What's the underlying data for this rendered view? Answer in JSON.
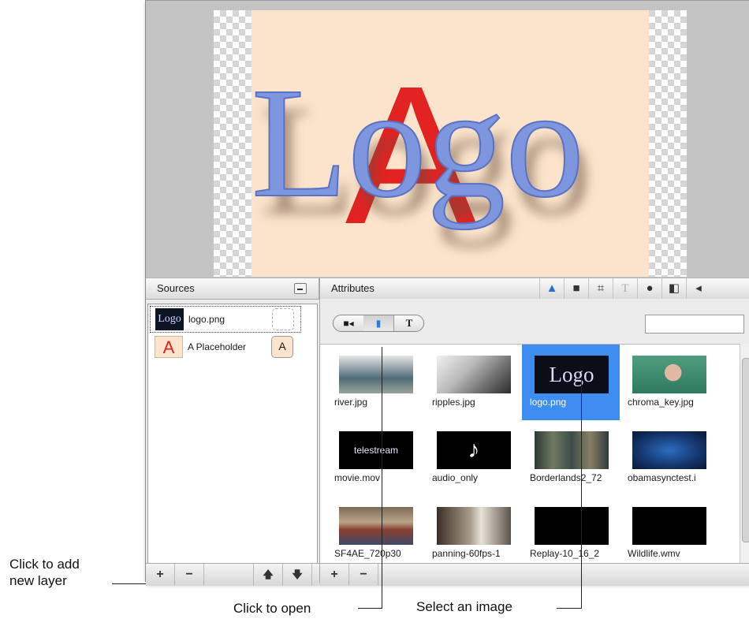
{
  "annotations": {
    "add_layer": "Click to add\nnew layer",
    "open": "Click to open",
    "select_image": "Select an image"
  },
  "preview": {
    "logo_text": "Logo",
    "placeholder_letter": "A"
  },
  "sources": {
    "title": "Sources",
    "items": [
      {
        "label": "logo.png",
        "thumb_text": "Logo"
      },
      {
        "label": "A Placeholder",
        "thumb_text": "A",
        "button_text": "A"
      }
    ],
    "toolbar": {
      "add": "+",
      "remove": "−",
      "up": "🡅",
      "down": "🡇"
    }
  },
  "attributes": {
    "title": "Attributes",
    "tabs": [
      "shapes-icon",
      "folder-icon",
      "crop-icon",
      "text-icon",
      "person-icon",
      "split-icon",
      "speaker-icon"
    ],
    "segment": {
      "video": "■◂",
      "image": "▮",
      "text": "T"
    },
    "search": {
      "value": "",
      "placeholder": ""
    },
    "media": [
      {
        "name": "river.jpg",
        "selected": false
      },
      {
        "name": "ripples.jpg",
        "selected": false
      },
      {
        "name": "logo.png",
        "selected": true
      },
      {
        "name": "chroma_key.jpg",
        "selected": false
      },
      {
        "name": "movie.mov",
        "selected": false
      },
      {
        "name": "audio_only",
        "selected": false
      },
      {
        "name": "Borderlands2_72",
        "selected": false
      },
      {
        "name": "obamasynctest.i",
        "selected": false
      },
      {
        "name": "SF4AE_720p30",
        "selected": false
      },
      {
        "name": "panning-60fps-1",
        "selected": false
      },
      {
        "name": "Replay-10_16_2",
        "selected": false
      },
      {
        "name": "Wildlife.wmv",
        "selected": false
      }
    ],
    "thumb_texts": {
      "logo": "Logo",
      "movie": "telestream"
    },
    "toolbar": {
      "add": "+",
      "remove": "−"
    }
  }
}
